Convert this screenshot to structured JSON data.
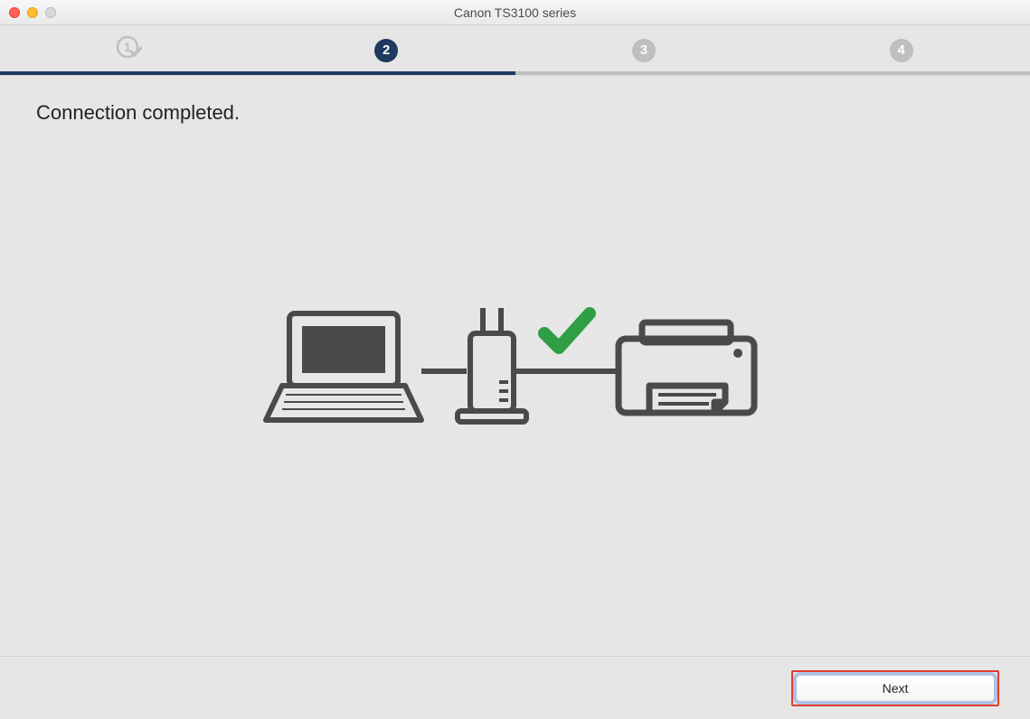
{
  "window": {
    "title": "Canon TS3100 series"
  },
  "steps": {
    "items": [
      "1",
      "2",
      "3",
      "4"
    ],
    "active_index": 1,
    "completed_index_max": 0,
    "progress_percent": 50
  },
  "main": {
    "heading": "Connection completed."
  },
  "icons": {
    "laptop": "laptop-icon",
    "router": "router-icon",
    "check": "check-icon",
    "printer": "printer-icon"
  },
  "footer": {
    "next_label": "Next"
  },
  "colors": {
    "step_active_bg": "#1f3a5f",
    "step_inactive_bg": "#bfbfbf",
    "check_green": "#2f9e44",
    "highlight_red": "#e23b2e"
  }
}
